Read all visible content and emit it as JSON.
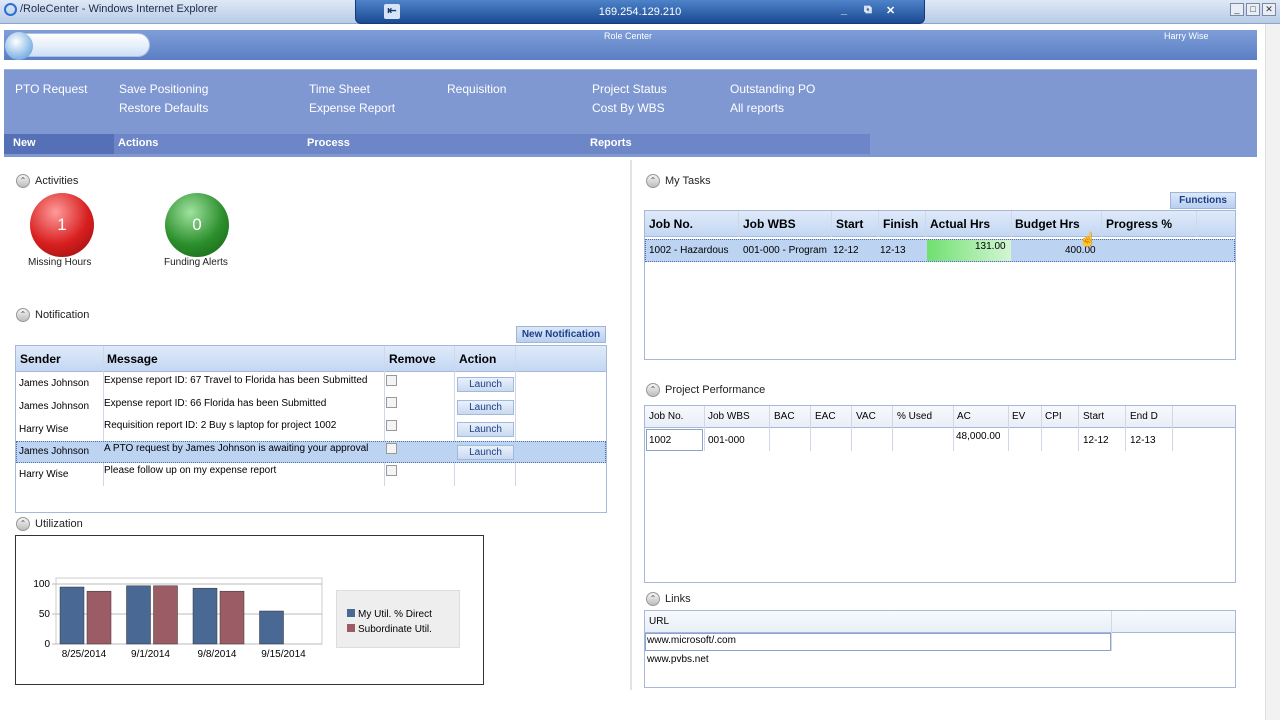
{
  "window": {
    "title": "/RoleCenter - Windows Internet Explorer",
    "rdp_ip": "169.254.129.210"
  },
  "banner": {
    "center": "Role Center",
    "user": "Harry Wise"
  },
  "ribbon": {
    "new": [
      "PTO Request"
    ],
    "actions": [
      "Save Positioning",
      "Restore Defaults"
    ],
    "process": [
      "Time Sheet",
      "Expense Report",
      "Requisition"
    ],
    "reports": [
      "Project Status",
      "Cost By WBS",
      "Outstanding PO",
      "All reports"
    ],
    "tabs": {
      "new": "New",
      "actions": "Actions",
      "process": "Process",
      "reports": "Reports"
    }
  },
  "activities": {
    "title": "Activities",
    "missing_hours": {
      "value": "1",
      "label": "Missing Hours",
      "color": "#d81f1f"
    },
    "funding_alerts": {
      "value": "0",
      "label": "Funding Alerts",
      "color": "#2c8f2c"
    }
  },
  "notification": {
    "title": "Notification",
    "new_button": "New Notification",
    "headers": {
      "sender": "Sender",
      "message": "Message",
      "remove": "Remove",
      "action": "Action"
    },
    "launch_label": "Launch",
    "rows": [
      {
        "sender": "James Johnson",
        "message": "Expense report   ID: 67 Travel to Florida has been Submitted"
      },
      {
        "sender": "James Johnson",
        "message": "Expense report   ID: 66 Florida has been Submitted"
      },
      {
        "sender": "Harry Wise",
        "message": "Requisition report   ID: 2 Buy s laptop for project 1002"
      },
      {
        "sender": "James Johnson",
        "message": "A PTO request by James Johnson is awaiting your approval"
      },
      {
        "sender": "Harry Wise",
        "message": "Please follow up on my expense report"
      }
    ]
  },
  "utilization": {
    "title": "Utilization",
    "legend": [
      "My Util. % Direct",
      "Subordinate Util."
    ],
    "colors": [
      "#4a6894",
      "#9c5c66"
    ]
  },
  "chart_data": {
    "type": "bar",
    "categories": [
      "8/25/2014",
      "9/1/2014",
      "9/8/2014",
      "9/15/2014"
    ],
    "series": [
      {
        "name": "My Util. % Direct",
        "values": [
          95,
          97,
          93,
          55
        ]
      },
      {
        "name": "Subordinate Util.",
        "values": [
          88,
          97,
          88,
          null
        ]
      }
    ],
    "yticks": [
      "100",
      "50",
      "0"
    ],
    "ylim": [
      0,
      100
    ]
  },
  "my_tasks": {
    "title": "My Tasks",
    "functions": "Functions",
    "headers": [
      "Job No.",
      "Job WBS",
      "Start",
      "Finish",
      "Actual Hrs",
      "Budget Hrs",
      "Progress %"
    ],
    "row": {
      "job_no": "1002 - Hazardous",
      "job_wbs": "001-000 - Program",
      "start": "12-12",
      "finish": "12-13",
      "actual": "131.00",
      "budget": "400.00",
      "progress": ""
    }
  },
  "project_performance": {
    "title": "Project Performance",
    "headers": [
      "Job No.",
      "Job WBS",
      "BAC",
      "EAC",
      "VAC",
      "% Used",
      "AC",
      "EV",
      "CPI",
      "Start",
      "End D"
    ],
    "row": {
      "job_no": "1002",
      "job_wbs": "001-000",
      "ac": "48,000.00",
      "start": "12-12",
      "end": "12-13"
    }
  },
  "links": {
    "title": "Links",
    "header": "URL",
    "rows": [
      "www.microsoft/.com",
      "www.pvbs.net"
    ]
  }
}
